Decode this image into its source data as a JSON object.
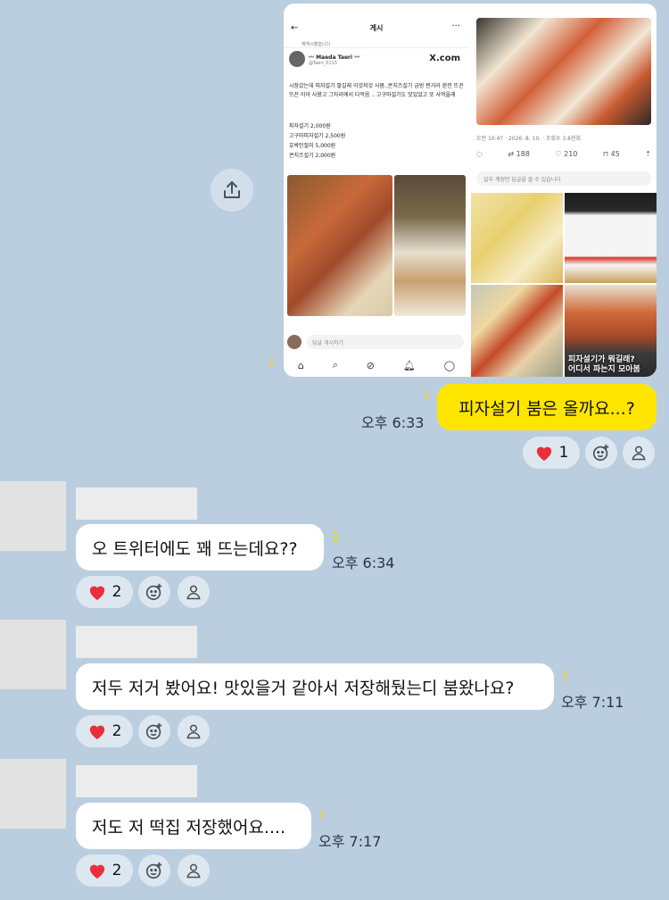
{
  "shared_image": {
    "left": {
      "header_title": "게시",
      "repost_note": "재게시했습니다",
      "author_name": "〰 Maeda Taeri 〰",
      "author_handle": "@Taeri_0115",
      "x_logo": "X.com",
      "body": "시장갔는데 피자설기 팔길래 이것저것 사봄..콘치즈설기 금방 찐거라 완전 뜨끈뜨끈 아아 사왔고 그자리에서 다먹음 .. 고구마설기도 맛있었고 또 사먹을래",
      "prices": [
        "피자설기 2,000원",
        "고구마피자설기 2,500원",
        "호박인절미 5,000원",
        "콘치즈설기 2,000원"
      ],
      "reply_placeholder": "답글 게시하기",
      "notif_badge": "1"
    },
    "right": {
      "meta": "오전 10:47 · 2026. 8. 10. · 조회수 3.8천회",
      "retweets": "188",
      "likes": "210",
      "bookmarks": "45",
      "reply_placeholder": "일부 계정만 답글을 쓸 수 있습니다",
      "promo_title": "피자설기가 뭐길래?",
      "promo_sub": "어디서 파는지 모아봄"
    },
    "unread": "1"
  },
  "messages": [
    {
      "text": "피자설기 붐은 올까요...?",
      "time": "오후 6:33",
      "unread": "1",
      "heart_count": "1"
    },
    {
      "text": "오 트위터에도 꽤 뜨는데요??",
      "time": "오후 6:34",
      "unread": "1",
      "heart_count": "2"
    },
    {
      "text": "저두 저거 봤어요! 맛있을거 같아서 저장해뒀는디 붐왔나요?",
      "time": "오후 7:11",
      "unread": "1",
      "heart_count": "2"
    },
    {
      "text": "저도 저 떡집 저장했어요....",
      "time": "오후 7:17",
      "unread": "1",
      "heart_count": "2"
    }
  ],
  "colors": {
    "background": "#bacee0",
    "my_bubble": "#fee500",
    "unread": "#f5d21b",
    "heart": "#e8303c"
  }
}
